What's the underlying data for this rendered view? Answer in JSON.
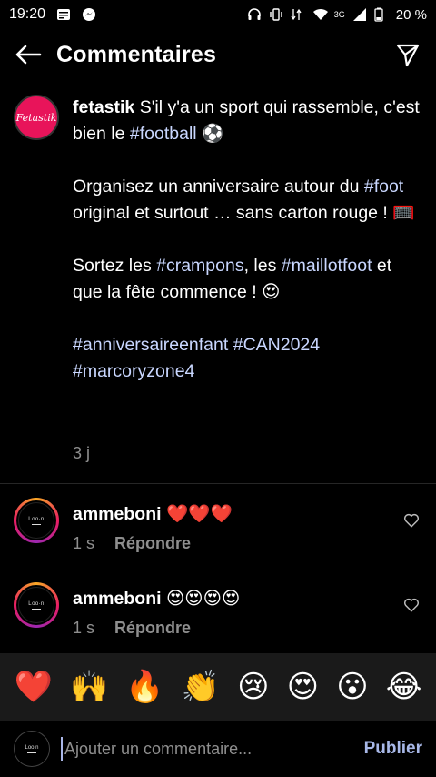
{
  "status_bar": {
    "time": "19:20",
    "network": "3G",
    "battery": "20 %"
  },
  "header": {
    "title": "Commentaires"
  },
  "caption": {
    "username": "fetastik",
    "avatar_text": "Fetastik",
    "line1a": "S'il y'a un sport qui rassemble, c'est bien le ",
    "line1_tag": "#football",
    "line1_emoji": " ⚽",
    "p2a": "Organisez un anniversaire autour du ",
    "p2_tag": "#foot",
    "p2b": " original et surtout … sans carton rouge ! 🥅",
    "p3a": "Sortez les ",
    "p3_tag1": "#crampons",
    "p3b": ", les ",
    "p3_tag2": "#maillotfoot",
    "p3c": " et que la fête commence ! 😍",
    "tag_a": "#anniversaireenfant",
    "tag_b": "#CAN2024",
    "tag_c": "#marcoryzone4",
    "time": "3 j"
  },
  "comments": [
    {
      "username": "ammeboni",
      "text": "❤️❤️❤️",
      "time": "1 s",
      "reply": "Répondre"
    },
    {
      "username": "ammeboni",
      "text": "😍😍😍😍",
      "time": "1 s",
      "reply": "Répondre"
    }
  ],
  "emoji_bar": [
    "❤️",
    "🙌",
    "🔥",
    "👏",
    "😢",
    "😍",
    "😮",
    "😂"
  ],
  "input": {
    "placeholder": "Ajouter un commentaire...",
    "publish": "Publier"
  }
}
